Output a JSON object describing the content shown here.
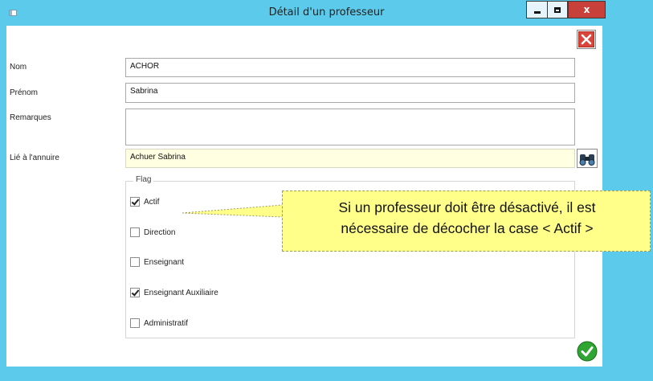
{
  "window": {
    "title": "Détail d'un professeur",
    "close_glyph": "x",
    "colors": {
      "frame": "#5ccbeb",
      "close": "#c7413a",
      "readonly_bg": "#ffffe2",
      "callout_bg": "#ffff8a"
    }
  },
  "form": {
    "nom": {
      "label": "Nom",
      "value": "ACHOR"
    },
    "prenom": {
      "label": "Prénom",
      "value": "Sabrina"
    },
    "remarques": {
      "label": "Remarques",
      "value": ""
    },
    "annuaire": {
      "label": "Lié à l'annuire",
      "value": "Achuer Sabrina"
    }
  },
  "flags": {
    "legend": "Flag",
    "items": [
      {
        "label": "Actif",
        "checked": true
      },
      {
        "label": "Direction",
        "checked": false
      },
      {
        "label": "Enseignant",
        "checked": false
      },
      {
        "label": "Enseignant Auxiliaire",
        "checked": true
      },
      {
        "label": "Administratif",
        "checked": false
      }
    ]
  },
  "callout": {
    "line1": "Si un professeur doit être désactivé, il est",
    "line2": "nécessaire de décocher la case < Actif >"
  },
  "icons": {
    "close_form": "close-x-red-icon",
    "search_annuaire": "binoculars-icon",
    "validate": "check-green-icon"
  }
}
